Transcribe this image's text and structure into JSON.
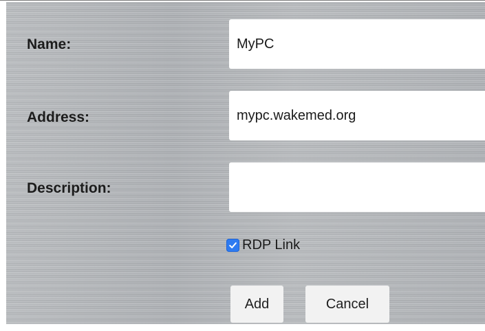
{
  "form": {
    "name_label": "Name:",
    "name_value": "MyPC",
    "address_label": "Address:",
    "address_value": "mypc.wakemed.org",
    "description_label": "Description:",
    "description_value": "",
    "rdp_link_label": "RDP Link",
    "rdp_link_checked": true,
    "add_label": "Add",
    "cancel_label": "Cancel"
  },
  "icons": {
    "checkbox": "checkmark-icon"
  },
  "colors": {
    "panel_background": "#b3b6b9",
    "field_background": "#ffffff",
    "checkbox_accent": "#2e7bf1",
    "button_background": "#f2f2f2"
  }
}
